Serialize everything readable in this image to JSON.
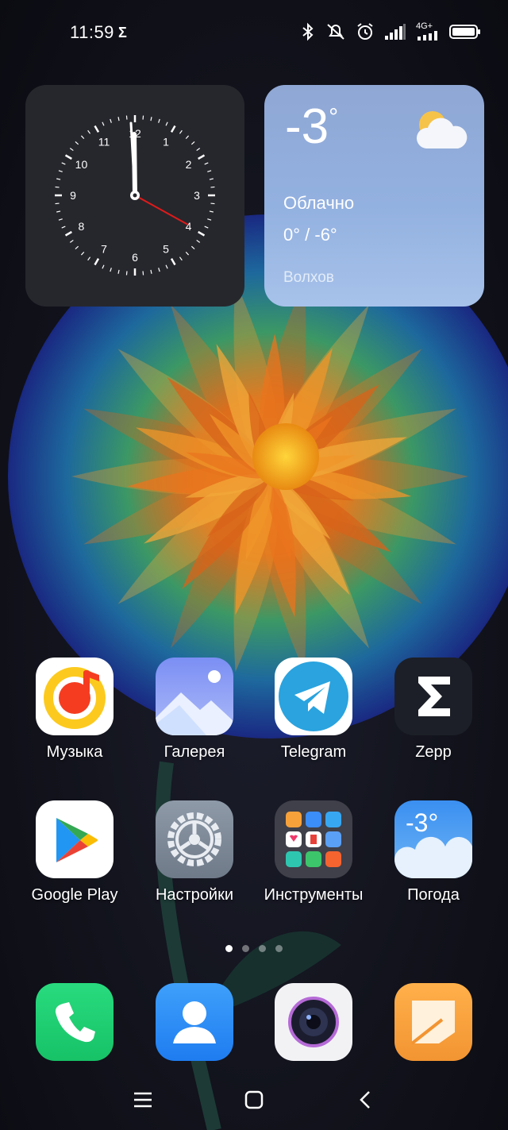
{
  "status_bar": {
    "time": "11:59",
    "sigma": "Σ",
    "network": "4G+",
    "icons": [
      "bluetooth-icon",
      "mute-icon",
      "alarm-icon",
      "signal-icon",
      "mobile-data-icon",
      "battery-icon"
    ]
  },
  "clock_widget": {
    "numbers": [
      "12",
      "1",
      "2",
      "3",
      "4",
      "5",
      "6",
      "7",
      "8",
      "9",
      "10",
      "11"
    ],
    "time": "11:59",
    "hand_color": "#e01a1a"
  },
  "weather_widget": {
    "temperature": "-3",
    "degree": "°",
    "condition": "Облачно",
    "range": "0° / -6°",
    "city": "Волхов"
  },
  "apps_row1": [
    {
      "label": "Музыка",
      "icon": "music-icon"
    },
    {
      "label": "Галерея",
      "icon": "gallery-icon"
    },
    {
      "label": "Telegram",
      "icon": "telegram-icon"
    },
    {
      "label": "Zepp",
      "icon": "zepp-icon"
    }
  ],
  "apps_row2": [
    {
      "label": "Google Play",
      "icon": "google-play-icon"
    },
    {
      "label": "Настройки",
      "icon": "settings-icon"
    },
    {
      "label": "Инструменты",
      "icon": "tools-folder-icon"
    },
    {
      "label": "Погода",
      "icon": "weather-app-icon"
    }
  ],
  "weather_app_icon_text": "-3°",
  "page_indicator": {
    "count": 4,
    "active": 1
  },
  "dock": [
    {
      "icon": "phone-icon"
    },
    {
      "icon": "contacts-icon"
    },
    {
      "icon": "camera-icon"
    },
    {
      "icon": "notes-icon"
    }
  ],
  "nav_bar": [
    "menu-icon",
    "home-icon",
    "back-icon"
  ],
  "colors": {
    "telegram": "#2aa3df",
    "phone": "#1fcf72",
    "contacts": "#2f8cf6",
    "notes": "#f5a13a",
    "weather_bg": "#93b1e0"
  }
}
